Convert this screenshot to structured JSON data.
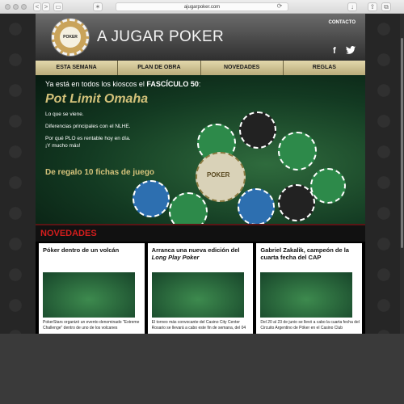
{
  "browser": {
    "url": "ajugarpoker.com",
    "back_label": "<",
    "forward_label": ">",
    "sidebar_label": "▭",
    "share_label": "⇪",
    "tabs_label": "⧉",
    "reload_label": "⟳"
  },
  "site": {
    "logo_text": "POKER",
    "title": "A JUGAR POKER",
    "contact_label": "CONTACTO",
    "facebook_label": "f",
    "twitter_label": "🐦"
  },
  "nav": {
    "items": [
      {
        "label": "ESTA SEMANA"
      },
      {
        "label": "PLAN DE OBRA"
      },
      {
        "label": "NOVEDADES"
      },
      {
        "label": "REGLAS"
      }
    ]
  },
  "hero": {
    "line1_prefix": "Ya está en todos los kioscos el ",
    "line1_bold": "FASCÍCULO 50",
    "line1_suffix": ":",
    "title": "Pot Limit Omaha",
    "bullet1": "Lo que se viene.",
    "bullet2": "Diferencias principales con el NLHE.",
    "bullet3": "Por qué PLO es rentable hoy en día.",
    "bullet4": "¡Y mucho más!",
    "gift": "De regalo 10 fichas de juego",
    "chip_logo": "POKER"
  },
  "novedades": {
    "title": "NOVEDADES",
    "cards": [
      {
        "title": "Póker dentro de un volcán",
        "text": "PokerStars organizó un evento denominado \"Extreme Challenge\" dentro de uno de los volcanes"
      },
      {
        "title_prefix": "Arranca una nueva edición del ",
        "title_italic": "Long Play Poker",
        "text": "El torneo más convocante del Casino City Center Rosario se llevará a cabo este fin de semana, del 04"
      },
      {
        "title": "Gabriel Zakalik, campeón de la cuarta fecha del CAP",
        "text": "Del 20 al 23 de junio se llevó a cabo la cuarta fecha del Circuito Argentino de Póker en el Casino Club"
      }
    ]
  },
  "colors": {
    "accent_red": "#d41d1d",
    "gold": "#d4c27a",
    "nav_bg": "#e3d8ac"
  }
}
